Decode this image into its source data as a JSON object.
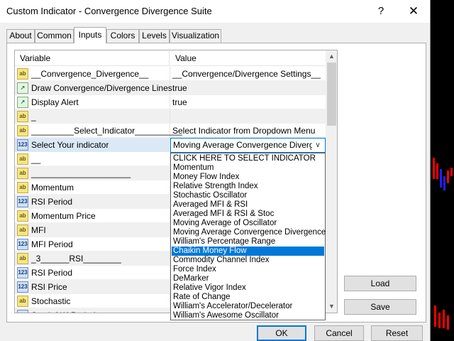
{
  "window": {
    "title": "Custom Indicator - Convergence Divergence Suite",
    "help_glyph": "?",
    "close_glyph": "✕"
  },
  "tabs": [
    {
      "label": "About",
      "active": false
    },
    {
      "label": "Common",
      "active": false
    },
    {
      "label": "Inputs",
      "active": true
    },
    {
      "label": "Colors",
      "active": false
    },
    {
      "label": "Levels",
      "active": false
    },
    {
      "label": "Visualization",
      "active": false
    }
  ],
  "grid": {
    "headers": {
      "variable": "Variable",
      "value": "Value"
    },
    "rows": [
      {
        "icon": "ab",
        "variable": "__Convergence_Divergence__",
        "value": "__Convergence/Divergence Settings__"
      },
      {
        "icon": "chart",
        "variable": "Draw Convergence/Divergence Lines",
        "value": "true"
      },
      {
        "icon": "chart",
        "variable": "Display Alert",
        "value": "true"
      },
      {
        "icon": "ab",
        "variable": "_",
        "value": ""
      },
      {
        "icon": "ab",
        "variable": "_________Select_Indicator__________",
        "value": "Select Indicator from Dropdown Menu"
      },
      {
        "icon": "num",
        "variable": "Select Your indicator",
        "value": ""
      },
      {
        "icon": "ab",
        "variable": "__",
        "value": ""
      },
      {
        "icon": "ab",
        "variable": "_____________________",
        "value": ""
      },
      {
        "icon": "ab",
        "variable": "Momentum",
        "value": ""
      },
      {
        "icon": "num",
        "variable": "RSI Period",
        "value": ""
      },
      {
        "icon": "ab",
        "variable": "Momentum Price",
        "value": ""
      },
      {
        "icon": "ab",
        "variable": "MFI",
        "value": ""
      },
      {
        "icon": "num",
        "variable": "MFI Period",
        "value": ""
      },
      {
        "icon": "ab",
        "variable": "_3______RSI________",
        "value": ""
      },
      {
        "icon": "num",
        "variable": "RSI Period",
        "value": ""
      },
      {
        "icon": "num",
        "variable": "RSI Price",
        "value": ""
      },
      {
        "icon": "ab",
        "variable": "Stochastic",
        "value": ""
      },
      {
        "icon": "num",
        "variable": "Stoch %K Period",
        "value": ""
      }
    ],
    "selected_row": 5
  },
  "combo": {
    "value": "Moving Average Convergence Divergence",
    "arrow": "∨"
  },
  "dropdown": {
    "highlighted": 10,
    "items": [
      "CLICK HERE TO SELECT INDICATOR",
      "Momentum",
      "Money Flow Index",
      "Relative Strength Index",
      "Stochastic Oscillator",
      "Averaged MFI & RSI",
      "Averaged MFI & RSI & Stoc",
      "Moving Average of Oscillator",
      "Moving Average Convergence Divergence",
      "William's Percentage Range",
      "Chaikin Money Flow",
      "Commodity Channel Index",
      "Force Index",
      "DeMarker",
      "Relative Vigor Index",
      "Rate of Change",
      "William's Accelerator/Decelerator",
      "William's Awesome Oscillator"
    ]
  },
  "buttons": {
    "load": "Load",
    "save": "Save",
    "ok": "OK",
    "cancel": "Cancel",
    "reset": "Reset"
  },
  "icons": {
    "ab": "ab",
    "num": "123",
    "chart": "↗"
  },
  "colors": {
    "accent": "#0078d7",
    "selection": "#dbe9f7",
    "chart_up": "#ff0000",
    "chart_down": "#2020ff"
  }
}
